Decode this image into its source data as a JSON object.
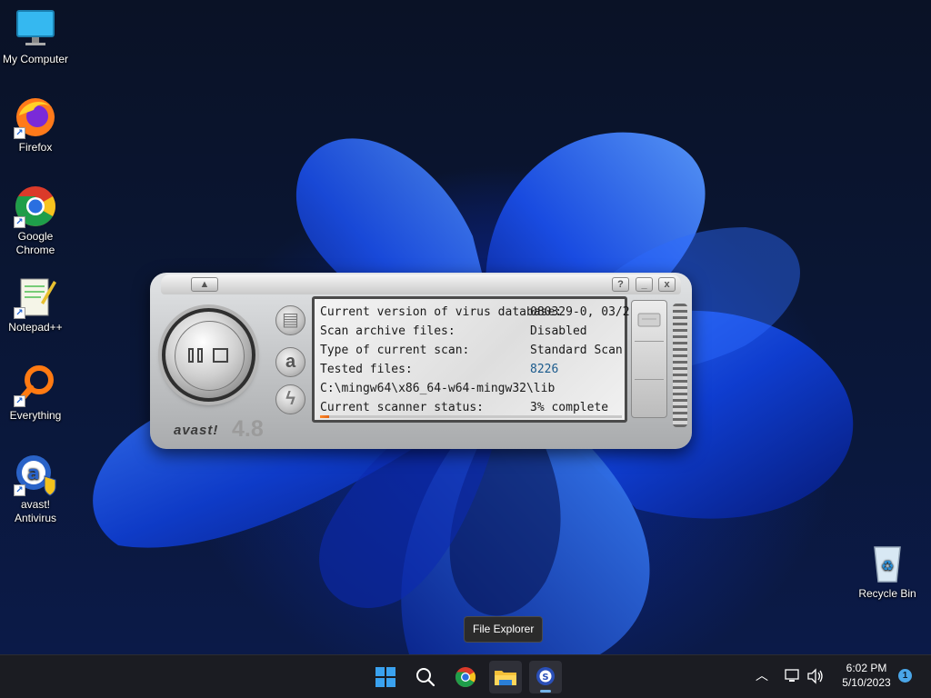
{
  "desktop": {
    "icons": [
      {
        "label": "My Computer"
      },
      {
        "label": "Firefox"
      },
      {
        "label": "Google Chrome"
      },
      {
        "label": "Notepad++"
      },
      {
        "label": "Everything"
      },
      {
        "label": "avast! Antivirus"
      }
    ],
    "recycle_bin": {
      "label": "Recycle Bin"
    }
  },
  "avast": {
    "brand": "avast!",
    "version": "4.8",
    "title_buttons": {
      "help": "?",
      "minimize": "_",
      "close": "x"
    },
    "rows": [
      {
        "label": "Current version of virus database:",
        "value": "080329-0, 03/2..."
      },
      {
        "label": "Scan archive files:",
        "value": "Disabled"
      },
      {
        "label": "Type of current scan:",
        "value": "Standard Scan"
      },
      {
        "label": "Tested files:",
        "value": "8226"
      }
    ],
    "current_path": "C:\\mingw64\\x86_64-w64-mingw32\\lib",
    "status_label": "Current scanner status:",
    "status_value": "3% complete",
    "progress_fraction": 0.03
  },
  "tooltip": {
    "text": "File Explorer"
  },
  "taskbar": {
    "apps": [
      {
        "name": "start-icon"
      },
      {
        "name": "search-icon"
      },
      {
        "name": "chrome-icon"
      },
      {
        "name": "file-explorer-icon"
      },
      {
        "name": "avast-icon"
      }
    ],
    "clock": {
      "time": "6:02 PM",
      "date": "5/10/2023"
    },
    "notification_count": "1"
  },
  "colors": {
    "accent": "#1a5a8c",
    "taskbar": "#1b1c22",
    "progress": "#ff8a2a"
  }
}
